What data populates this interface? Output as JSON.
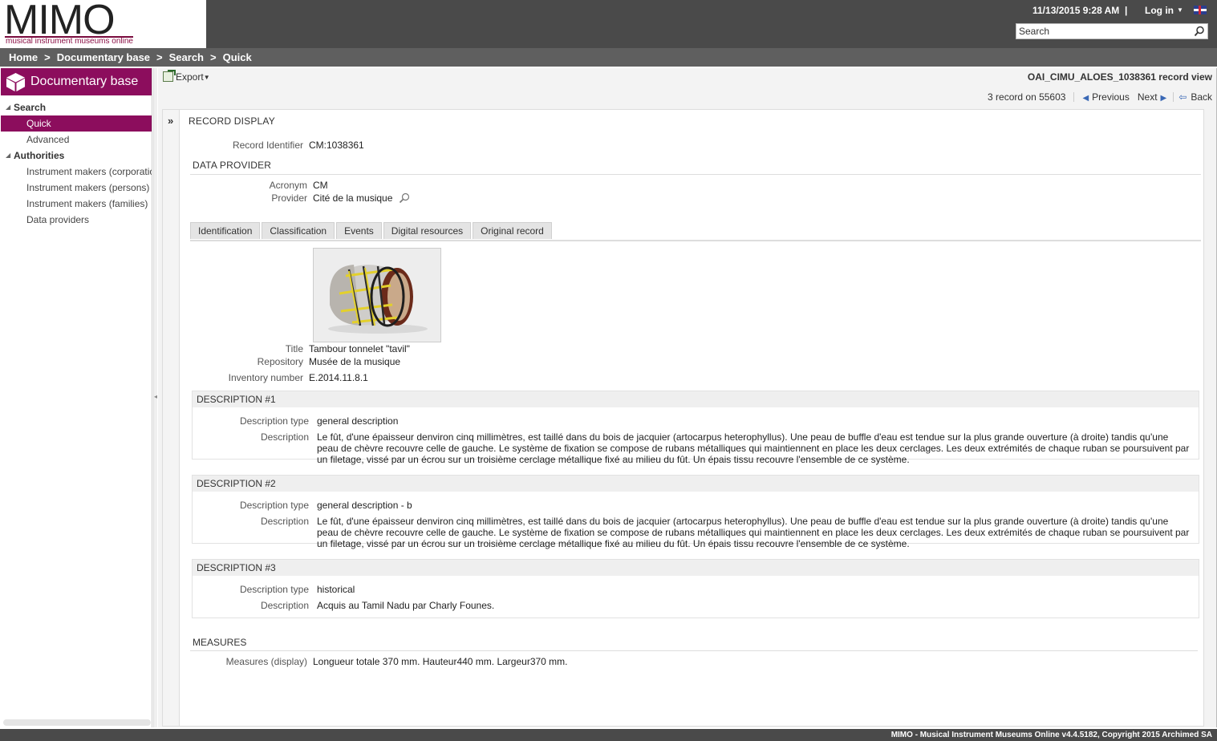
{
  "header": {
    "logo_text": "MIMO",
    "logo_subtitle": "musical instrument museums online",
    "datetime": "11/13/2015 9:28 AM",
    "datetime_sep": "|",
    "login_label": "Log in",
    "flag_icon": "uk-flag-icon",
    "search_placeholder": "Search"
  },
  "breadcrumb": [
    "Home",
    "Documentary base",
    "Search",
    "Quick"
  ],
  "breadcrumb_sep": ">",
  "sidebar": {
    "title": "Documentary base",
    "groups": [
      {
        "label": "Search",
        "items": [
          {
            "label": "Quick",
            "active": true
          },
          {
            "label": "Advanced",
            "active": false
          }
        ]
      },
      {
        "label": "Authorities",
        "items": [
          {
            "label": "Instrument makers (corporations)",
            "active": false
          },
          {
            "label": "Instrument makers (persons)",
            "active": false
          },
          {
            "label": "Instrument makers (families)",
            "active": false
          },
          {
            "label": "Data providers",
            "active": false
          }
        ]
      }
    ]
  },
  "toolbar": {
    "export_label": "Export",
    "record_title": "OAI_CIMU_ALOES_1038361 record view",
    "record_count": "3 record on 55603",
    "previous_label": "Previous",
    "next_label": "Next",
    "back_label": "Back"
  },
  "record": {
    "display_title": "RECORD DISPLAY",
    "identifier_label": "Record Identifier",
    "identifier_value": "CM:1038361",
    "provider_section": "DATA PROVIDER",
    "acronym_label": "Acronym",
    "acronym_value": "CM",
    "provider_label": "Provider",
    "provider_value": "Cité de la musique",
    "tabs": [
      "Identification",
      "Classification",
      "Events",
      "Digital resources",
      "Original record"
    ],
    "title_label": "Title",
    "title_value": "Tambour tonnelet \"tavil\"",
    "repository_label": "Repository",
    "repository_value": "Musée de la musique",
    "inventory_label": "Inventory number",
    "inventory_value": "E.2014.11.8.1",
    "descriptions": [
      {
        "header": "DESCRIPTION #1",
        "type_label": "Description type",
        "type_value": "general description",
        "desc_label": "Description",
        "desc_value": "Le fût, d'une épaisseur denviron cinq millimètres, est taillé dans du bois de jacquier (artocarpus heterophyllus). Une peau de buffle d'eau est tendue sur la plus grande ouverture (à droite) tandis qu'une peau de chèvre recouvre celle de gauche. Le système de fixation se compose de rubans métalliques qui maintiennent en place les deux cerclages. Les deux extrémités de chaque ruban se poursuivent par un filetage, vissé par un écrou sur un troisième cerclage métallique fixé au milieu du fût. Un épais tissu recouvre l'ensemble de ce système."
      },
      {
        "header": "DESCRIPTION #2",
        "type_label": "Description type",
        "type_value": "general description - b",
        "desc_label": "Description",
        "desc_value": "Le fût, d'une épaisseur denviron cinq millimètres, est taillé dans du bois de jacquier (artocarpus heterophyllus). Une peau de buffle d'eau est tendue sur la plus grande ouverture (à droite) tandis qu'une peau de chèvre recouvre celle de gauche. Le système de fixation se compose de rubans métalliques qui maintiennent en place les deux cerclages. Les deux extrémités de chaque ruban se poursuivent par un filetage, vissé par un écrou sur un troisième cerclage métallique fixé au milieu du fût. Un épais tissu recouvre l'ensemble de ce système."
      },
      {
        "header": "DESCRIPTION #3",
        "type_label": "Description type",
        "type_value": "historical",
        "desc_label": "Description",
        "desc_value": "Acquis au Tamil Nadu par Charly Founes."
      }
    ],
    "measures_section": "MEASURES",
    "measures_label": "Measures (display)",
    "measures_value": "Longueur totale 370 mm. Hauteur440 mm. Largeur370 mm."
  },
  "footer": "MIMO - Musical Instrument Museums Online v4.4.5182, Copyright 2015 Archimed SA",
  "colors": {
    "accent": "#8c0d5d",
    "header_bg": "#4a4a4a",
    "crumb_bg": "#5f5f5f"
  }
}
